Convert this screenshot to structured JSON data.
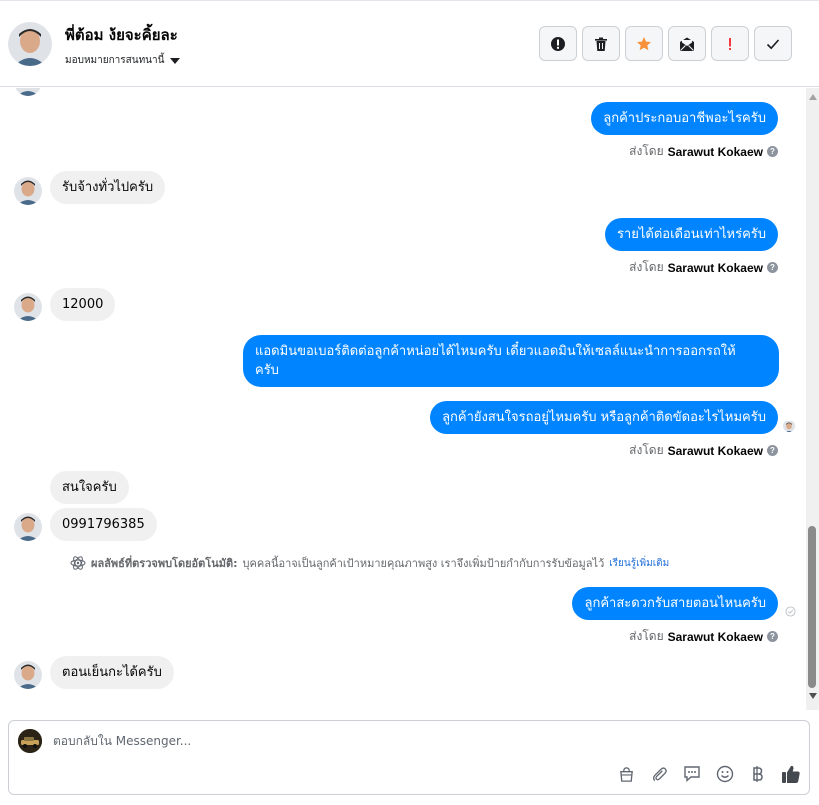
{
  "header": {
    "name": "พี่ต้อม ง้ยจะคิ้ยละ",
    "assign_label": "มอบหมายการสนทนานี้"
  },
  "toolbar": {
    "buttons": [
      {
        "icon": "alert-circle-icon"
      },
      {
        "icon": "trash-icon"
      },
      {
        "icon": "star-icon",
        "color": "#f7923b"
      },
      {
        "icon": "mail-unread-icon"
      },
      {
        "icon": "exclamation-icon",
        "color": "#fa383e"
      },
      {
        "icon": "check-icon"
      }
    ]
  },
  "thread": {
    "messages": [
      {
        "text": "ลูกค้าประกอบอาชีพอะไรครับ",
        "sent_by_prefix": "ส่งโดย",
        "sent_by": "Sarawut Kokaew"
      },
      {
        "text": "รับจ้างทั่วไปครับ"
      },
      {
        "text": "รายได้ต่อเดือนเท่าไหร่ครับ",
        "sent_by_prefix": "ส่งโดย",
        "sent_by": "Sarawut Kokaew"
      },
      {
        "text": "12000"
      },
      {
        "text_line1": "แอดมินขอเบอร์ติดต่อลูกค้าหน่อยได้ไหมครับ เดี๋ยวแอดมินให้เซลล์แนะนำการออกรถให้",
        "text_line2": "ครับ"
      },
      {
        "text": "ลูกค้ายังสนใจรถอยู่ไหมครับ หรือลูกค้าติดขัดอะไรไหมครับ",
        "sent_by_prefix": "ส่งโดย",
        "sent_by": "Sarawut Kokaew"
      },
      {
        "text": "สนใจครับ"
      },
      {
        "text": "0991796385"
      },
      {
        "text": "ลูกค้าสะดวกรับสายตอนไหนครับ",
        "sent_by_prefix": "ส่งโดย",
        "sent_by": "Sarawut Kokaew"
      },
      {
        "text": "ตอนเย็นกะได้ครับ"
      }
    ],
    "auto_detect": {
      "label": "ผลลัพธ์ที่ตรวจพบโดยอัตโนมัติ:",
      "text": "บุคคลนี้อาจเป็นลูกค้าเป้าหมายคุณภาพสูง เราจึงเพิ่มป้ายกำกับการรับข้อมูลไว้",
      "learn_more": "เรียนรู้เพิ่มเติม"
    }
  },
  "composer": {
    "placeholder": "ตอบกลับใน Messenger...",
    "tools": [
      "shopping-bag-icon",
      "paperclip-icon",
      "chat-bubble-icon",
      "emoji-icon",
      "baht-icon",
      "thumbs-up-icon"
    ]
  },
  "colors": {
    "outgoing_bubble": "#0084ff",
    "incoming_bubble": "#f0f0f0",
    "link": "#216fdb"
  }
}
